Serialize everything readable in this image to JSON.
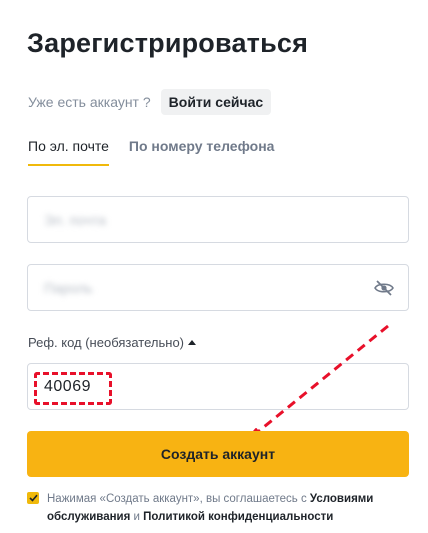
{
  "title": "Зарегистрироваться",
  "login_prompt": {
    "question": "Уже есть аккаунт ?",
    "button_label": "Войти сейчас"
  },
  "tabs": [
    {
      "label": "По эл. почте",
      "active": true
    },
    {
      "label": "По номеру телефона",
      "active": false
    }
  ],
  "form": {
    "email_placeholder": "Эл. почта",
    "password_placeholder": "Пароль",
    "ref_label": "Реф. код (необязательно)",
    "ref_value": "40069",
    "submit_label": "Создать аккаунт"
  },
  "agreement": {
    "checked": true,
    "text_before": "Нажимая «Создать аккаунт», вы соглашаетесь с ",
    "terms_link": "Условиями обслуживания",
    "and": " и ",
    "privacy_link": "Политикой конфиденциальности"
  },
  "colors": {
    "accent": "#f0b90b",
    "button": "#f8b312",
    "annotation": "#e8102a"
  },
  "icons": {
    "password_toggle": "eye-off-icon",
    "ref_toggle": "caret-up-icon",
    "checkbox": "check-icon",
    "annotation_arrow": "arrow-icon"
  }
}
